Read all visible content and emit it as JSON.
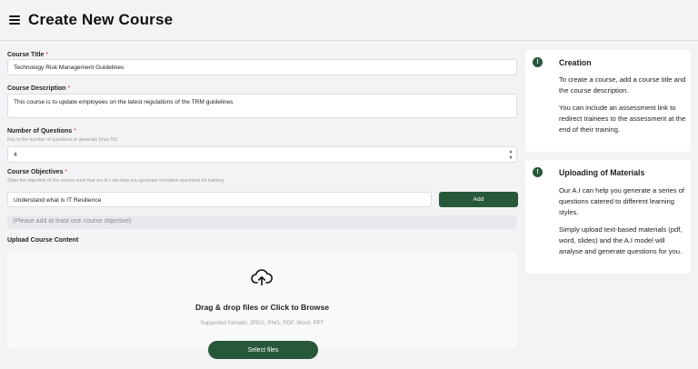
{
  "header": {
    "title": "Create New Course",
    "menu_icon": "hamburger-menu-icon"
  },
  "form": {
    "course_title": {
      "label": "Course Title",
      "required_mark": "*",
      "value": "Technology Risk Management Guidelines"
    },
    "course_description": {
      "label": "Course Description",
      "required_mark": "*",
      "value": "This course is to update employees on the latest regulations of the TRM guidelines"
    },
    "num_questions": {
      "label": "Number of Questions",
      "required_mark": "*",
      "hint": "Key in the number of questions to generate (max 50)",
      "value": "4"
    },
    "objectives": {
      "label": "Course Objectives",
      "required_mark": "*",
      "hint": "State the objective of the course such that our A.I can help you generate formative questions for training",
      "input_value": "Understand what is IT Resilience",
      "add_label": "Add",
      "empty_notice": "(Please add at least one course objective)"
    },
    "upload": {
      "label": "Upload Course Content",
      "icon": "cloud-upload-icon",
      "title": "Drag & drop files or Click to Browse",
      "formats": "Supported formats: JPEG, PNG, PDF, Word, PPT",
      "button_label": "Select files"
    }
  },
  "sidebar": {
    "creation": {
      "icon_glyph": "!",
      "title": "Creation",
      "text1": "To create a course, add a course title and the course description.",
      "text2": "You can include an assessment link to redirect trainees to the assessment at the end of their training."
    },
    "uploading": {
      "icon_glyph": "!",
      "title": "Uploading of Materials",
      "text1": "Our A.I can help you generate a series of questions catered to different learning styles.",
      "text2": "Simply upload text-based materials (pdf, word, slides) and the A.I model will analyse and generate questions for you."
    }
  },
  "colors": {
    "accent": "#27583a",
    "required": "#d9363e",
    "background": "#f3f3f5"
  }
}
